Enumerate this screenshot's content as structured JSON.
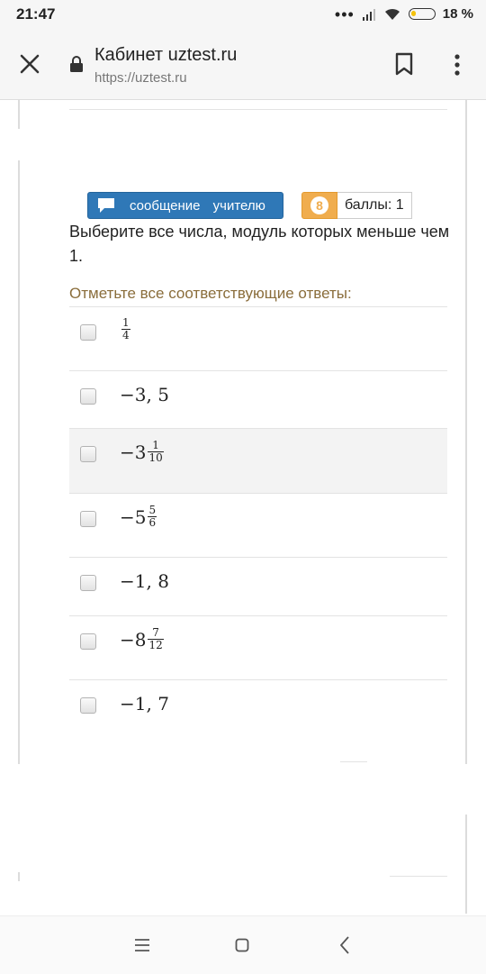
{
  "status_bar": {
    "time": "21:47",
    "battery": "18 %"
  },
  "browser": {
    "title": "Кабинет uztest.ru",
    "url": "https://uztest.ru"
  },
  "question": {
    "message_button": "сообщение учителю",
    "score_badge": "8",
    "score_label": "баллы: 1",
    "text": "Выберите все числа, модуль которых меньше чем 1.",
    "instruction": "Отметьте все соответствующие ответы:"
  },
  "options": [
    {
      "whole": "",
      "num": "1",
      "den": "4",
      "checked": false
    },
    {
      "whole": "−3, 5",
      "num": "",
      "den": "",
      "checked": false
    },
    {
      "whole": "−3",
      "num": "1",
      "den": "10",
      "checked": false,
      "highlighted": true
    },
    {
      "whole": "−5",
      "num": "5",
      "den": "6",
      "checked": false
    },
    {
      "whole": "−1, 8",
      "num": "",
      "den": "",
      "checked": false
    },
    {
      "whole": "−8",
      "num": "7",
      "den": "12",
      "checked": false
    },
    {
      "whole": "−1, 7",
      "num": "",
      "den": "",
      "checked": false
    }
  ],
  "icons": [
    "close-icon",
    "lock-icon",
    "bookmark-icon",
    "more-vert-icon",
    "chat-icon",
    "nav-menu-icon",
    "nav-home-icon",
    "nav-back-icon",
    "signal-icon",
    "wifi-icon",
    "battery-icon"
  ],
  "colors": {
    "message_button": "#2f78b7",
    "score_badge": "#f0ad4e",
    "instruction": "#8a6d3b"
  }
}
